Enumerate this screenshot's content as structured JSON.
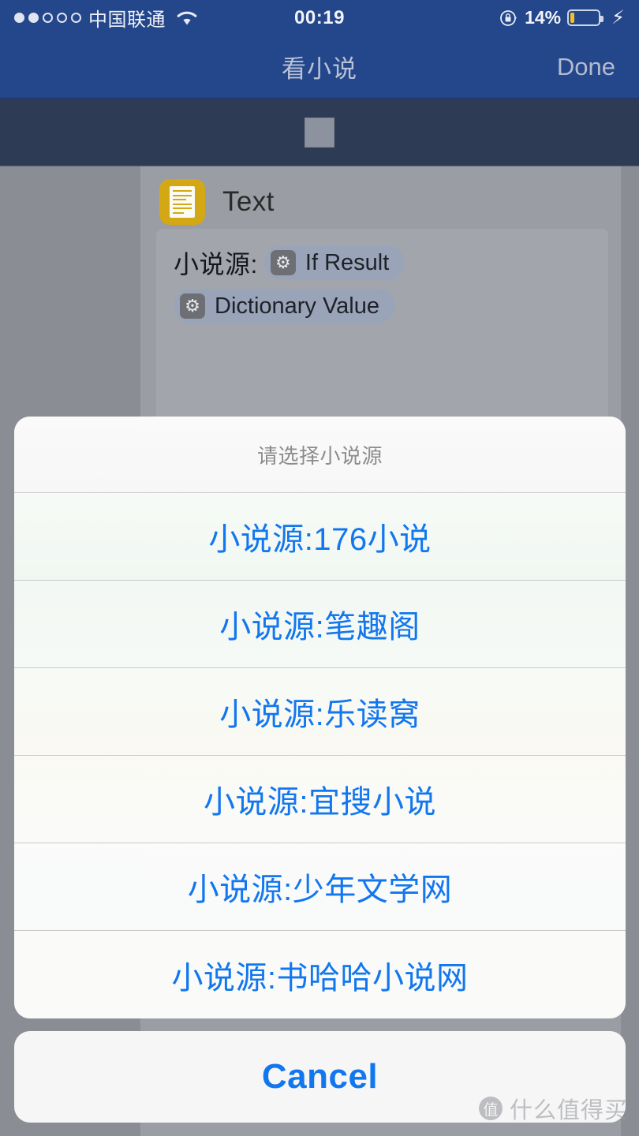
{
  "status_bar": {
    "signal_dots_filled": 2,
    "signal_dots_total": 5,
    "carrier": "中国联通",
    "wifi_icon": "wifi-icon",
    "time": "00:19",
    "rotation_lock_icon": "rotation-lock-icon",
    "battery_percent": "14%",
    "battery_level": 14,
    "battery_color": "#f2c12e",
    "charging_icon": "lightning-bolt-icon"
  },
  "nav_bar": {
    "title": "看小说",
    "done_label": "Done",
    "background_color": "#24468a"
  },
  "run_toolbar": {
    "stop_button_name": "stop-button",
    "background_color": "#2e3b54"
  },
  "action": {
    "icon_name": "text-document-icon",
    "icon_color": "#d4a715",
    "title": "Text",
    "field": {
      "prefix_text": "小说源:",
      "tokens": [
        {
          "label": "If Result",
          "icon": "gear-icon"
        },
        {
          "label": "Dictionary Value",
          "icon": "gear-icon"
        }
      ]
    }
  },
  "action_sheet": {
    "title": "请选择小说源",
    "options": [
      {
        "label": "小说源:176小说"
      },
      {
        "label": "小说源:笔趣阁"
      },
      {
        "label": "小说源:乐读窝"
      },
      {
        "label": "小说源:宜搜小说"
      },
      {
        "label": "小说源:少年文学网"
      },
      {
        "label": "小说源:书哈哈小说网"
      }
    ],
    "cancel_label": "Cancel",
    "tint_color": "#1277ef"
  },
  "watermark": {
    "logo_glyph": "值",
    "text": "什么值得买"
  }
}
